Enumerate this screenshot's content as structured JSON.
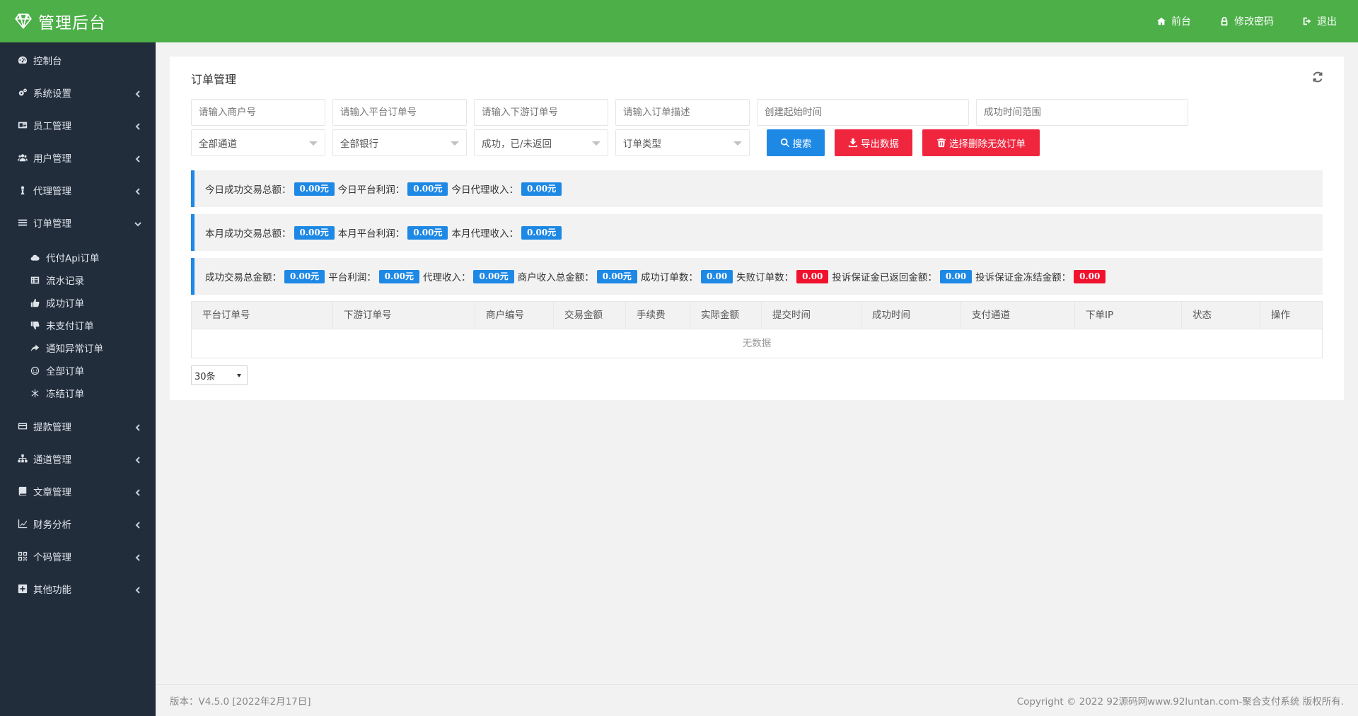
{
  "header": {
    "logo_text": "管理后台",
    "links": [
      {
        "label": "前台",
        "icon": "home-icon"
      },
      {
        "label": "修改密码",
        "icon": "lock-icon"
      },
      {
        "label": "退出",
        "icon": "sign-out-icon"
      }
    ],
    "color": "#4caf48"
  },
  "sidebar": {
    "items": [
      {
        "label": "控制台",
        "icon": "dashboard-icon"
      },
      {
        "label": "系统设置",
        "icon": "cogs-icon"
      },
      {
        "label": "员工管理",
        "icon": "id-card-icon"
      },
      {
        "label": "用户管理",
        "icon": "users-icon"
      },
      {
        "label": "代理管理",
        "icon": "user-icon"
      },
      {
        "label": "订单管理",
        "icon": "list-icon"
      },
      {
        "label": "提款管理",
        "icon": "credit-card-icon"
      },
      {
        "label": "通道管理",
        "icon": "sitemap-icon"
      },
      {
        "label": "文章管理",
        "icon": "book-icon"
      },
      {
        "label": "财务分析",
        "icon": "line-chart-icon"
      },
      {
        "label": "个码管理",
        "icon": "qrcode-icon"
      },
      {
        "label": "其他功能",
        "icon": "plus-square-icon"
      }
    ],
    "sub_items": [
      {
        "label": "代付Api订单",
        "icon": "cloud-icon"
      },
      {
        "label": "流水记录",
        "icon": "list-alt-icon"
      },
      {
        "label": "成功订单",
        "icon": "thumbs-up-icon"
      },
      {
        "label": "未支付订单",
        "icon": "thumbs-down-icon"
      },
      {
        "label": "通知异常订单",
        "icon": "share-icon"
      },
      {
        "label": "全部订单",
        "icon": "smile-icon"
      },
      {
        "label": "冻结订单",
        "icon": "snowflake-icon"
      }
    ],
    "color": "#222d3c"
  },
  "panel": {
    "title": "订单管理",
    "filters": {
      "merchant_placeholder": "请输入商户号",
      "platform_order_placeholder": "请输入平台订单号",
      "downstream_order_placeholder": "请输入下游订单号",
      "order_desc_placeholder": "请输入订单描述",
      "create_time_placeholder": "创建起始时间",
      "success_time_placeholder": "成功时间范围",
      "channel_select": "全部通道",
      "bank_select": "全部银行",
      "status_select": "成功，已/未返回",
      "type_select": "订单类型"
    },
    "buttons": {
      "search": "搜索",
      "export": "导出数据",
      "delete_invalid": "选择删除无效订单"
    },
    "stats_today": {
      "total_label": "今日成功交易总额：",
      "total": "0.00元",
      "profit_label": "今日平台利润：",
      "profit": "0.00元",
      "agent_label": "今日代理收入：",
      "agent": "0.00元"
    },
    "stats_month": {
      "total_label": "本月成功交易总额：",
      "total": "0.00元",
      "profit_label": "本月平台利润：",
      "profit": "0.00元",
      "agent_label": "本月代理收入：",
      "agent": "0.00元"
    },
    "stats_all": {
      "total_label": "成功交易总金额：",
      "total": "0.00元",
      "profit_label": "平台利润：",
      "profit": "0.00元",
      "agent_label": "代理收入：",
      "agent": "0.00元",
      "merchant_label": "商户收入总金额：",
      "merchant": "0.00元",
      "success_count_label": "成功订单数：",
      "success_count": "0.00",
      "fail_count_label": "失败订单数：",
      "fail_count": "0.00",
      "complaint_returned_label": "投诉保证金已返回金额：",
      "complaint_returned": "0.00",
      "complaint_frozen_label": "投诉保证金冻结金额：",
      "complaint_frozen": "0.00"
    },
    "table": {
      "columns": [
        "平台订单号",
        "下游订单号",
        "商户编号",
        "交易金额",
        "手续费",
        "实际金额",
        "提交时间",
        "成功时间",
        "支付通道",
        "下单IP",
        "状态",
        "操作"
      ],
      "empty_text": "无数据"
    },
    "page_size": "30条"
  },
  "footer": {
    "version": "版本：V4.5.0 [2022年2月17日]",
    "copyright": "Copyright © 2022 92源码网www.92luntan.com-聚合支付系统 版权所有."
  },
  "colors": {
    "accent_blue": "#1e88e5",
    "danger_red": "#f0263e"
  }
}
